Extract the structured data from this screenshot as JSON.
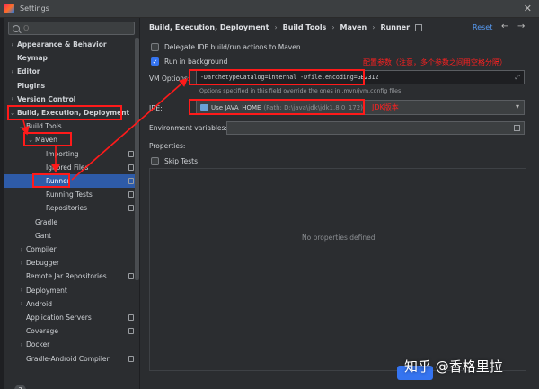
{
  "window": {
    "title": "Settings"
  },
  "sidebar": {
    "search_placeholder": "Q",
    "items": [
      {
        "label": "Appearance & Behavior",
        "chevron": "›",
        "indent": 0,
        "bold": true
      },
      {
        "label": "Keymap",
        "chevron": "",
        "indent": 0,
        "bold": true
      },
      {
        "label": "Editor",
        "chevron": "›",
        "indent": 0,
        "bold": true
      },
      {
        "label": "Plugins",
        "chevron": "",
        "indent": 0,
        "bold": true
      },
      {
        "label": "Version Control",
        "chevron": "›",
        "indent": 0,
        "bold": true
      },
      {
        "label": "Build, Execution, Deployment",
        "chevron": "⌄",
        "indent": 0,
        "bold": true
      },
      {
        "label": "Build Tools",
        "chevron": "⌄",
        "indent": 1,
        "bold": false
      },
      {
        "label": "Maven",
        "chevron": "⌄",
        "indent": 2,
        "bold": false
      },
      {
        "label": "Importing",
        "chevron": "",
        "indent": 3,
        "bold": false
      },
      {
        "label": "Ignored Files",
        "chevron": "",
        "indent": 3,
        "bold": false
      },
      {
        "label": "Runner",
        "chevron": "",
        "indent": 3,
        "bold": false
      },
      {
        "label": "Running Tests",
        "chevron": "",
        "indent": 3,
        "bold": false
      },
      {
        "label": "Repositories",
        "chevron": "",
        "indent": 3,
        "bold": false
      },
      {
        "label": "Gradle",
        "chevron": "",
        "indent": 2,
        "bold": false
      },
      {
        "label": "Gant",
        "chevron": "",
        "indent": 2,
        "bold": false
      },
      {
        "label": "Compiler",
        "chevron": "›",
        "indent": 1,
        "bold": false
      },
      {
        "label": "Debugger",
        "chevron": "›",
        "indent": 1,
        "bold": false
      },
      {
        "label": "Remote Jar Repositories",
        "chevron": "",
        "indent": 1,
        "bold": false
      },
      {
        "label": "Deployment",
        "chevron": "›",
        "indent": 1,
        "bold": false
      },
      {
        "label": "Android",
        "chevron": "›",
        "indent": 1,
        "bold": false
      },
      {
        "label": "Application Servers",
        "chevron": "",
        "indent": 1,
        "bold": false
      },
      {
        "label": "Coverage",
        "chevron": "",
        "indent": 1,
        "bold": false
      },
      {
        "label": "Docker",
        "chevron": "›",
        "indent": 1,
        "bold": false
      },
      {
        "label": "Gradle-Android Compiler",
        "chevron": "",
        "indent": 1,
        "bold": false
      }
    ],
    "selected_label": "Runner",
    "help": "?"
  },
  "main": {
    "breadcrumb": [
      "Build, Execution, Deployment",
      "Build Tools",
      "Maven",
      "Runner"
    ],
    "reset_label": "Reset",
    "back_glyph": "←",
    "forward_glyph": "→",
    "delegate_label": "Delegate IDE build/run actions to Maven",
    "background_label": "Run in background",
    "vm_label": "VM Options:",
    "vm_value": "-DarchetypeCatalog=internal -Dfile.encoding=GB2312",
    "vm_hint": "Options specified in this field override the ones in .mvn/jvm.config files",
    "jre_label": "JRE:",
    "jre_value": "Use JAVA_HOME",
    "jre_path": "(Path: D:\\java\\jdk\\jdk1.8.0_172)",
    "env_label": "Environment variables:",
    "properties_label": "Properties:",
    "skip_tests_label": "Skip Tests",
    "add_glyph": "+",
    "remove_glyph": "−",
    "edit_glyph": "✎",
    "empty_text": "No properties defined"
  },
  "annotations": {
    "vm_note": "配置参数（注意，多个参数之间用空格分隔）",
    "jdk_note": "JDK版本",
    "color": "#ff1a1a"
  },
  "watermark": "知乎 @香格里拉"
}
